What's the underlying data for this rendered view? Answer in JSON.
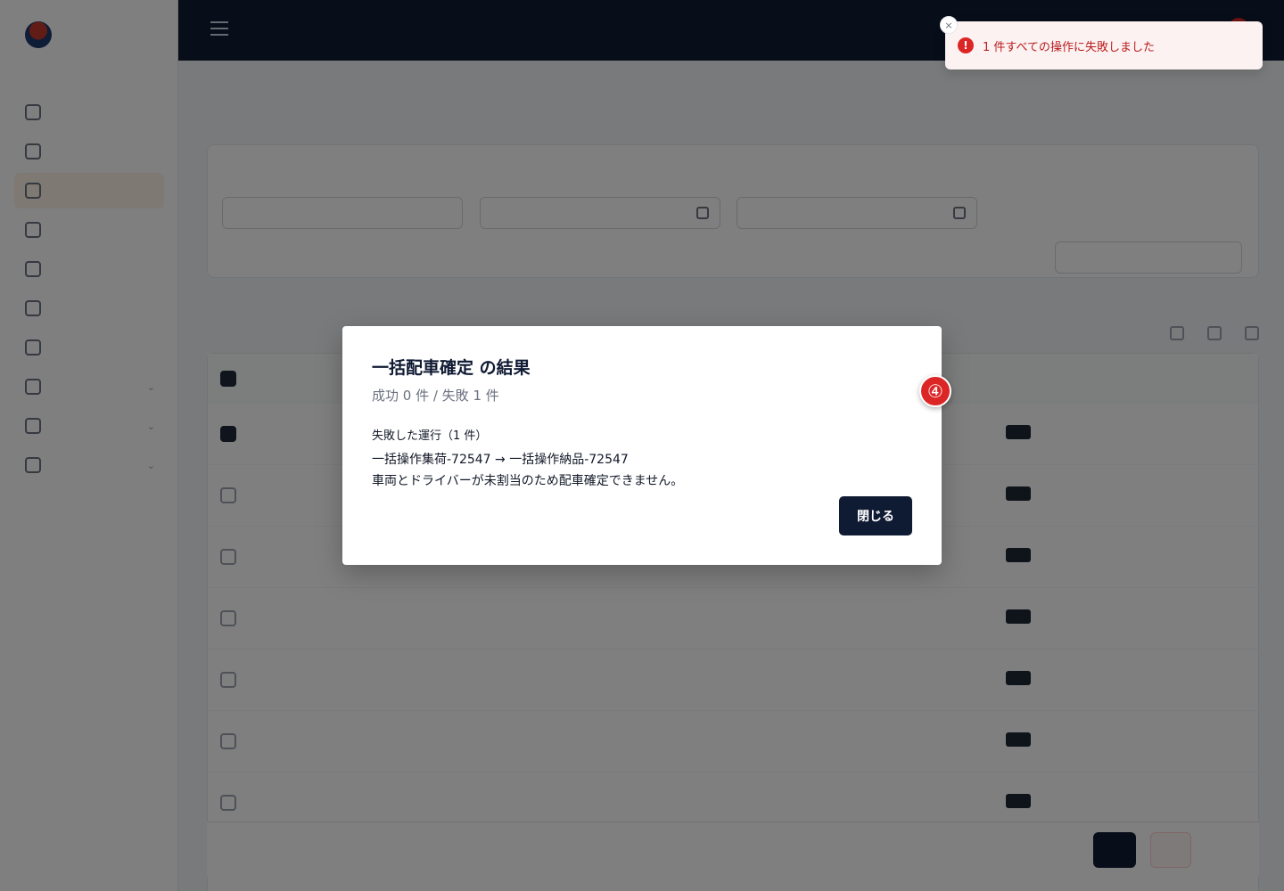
{
  "modal": {
    "title": "一括配車確定 の結果",
    "summary": "成功 0 件 / 失敗 1 件",
    "failed_heading": "失敗した運行（1 件）",
    "failed_items": [
      {
        "route": "一括操作集荷-72547 → 一括操作納品-72547",
        "reason": "車両とドライバーが未割当のため配車確定できません。"
      }
    ],
    "close_label": "閉じる"
  },
  "toast": {
    "message": "1 件すべての操作に失敗しました",
    "close_glyph": "×",
    "icon_glyph": "!"
  },
  "step_badge": "④",
  "colors": {
    "primary_dark": "#0f1a33",
    "error_red": "#dc2626",
    "toast_bg": "#fdf2f2",
    "overlay": "rgba(0,0,0,0.5)"
  },
  "icons": {
    "toast": "error-circle-icon",
    "toast_close": "close-icon",
    "menu": "hamburger-menu-icon"
  }
}
